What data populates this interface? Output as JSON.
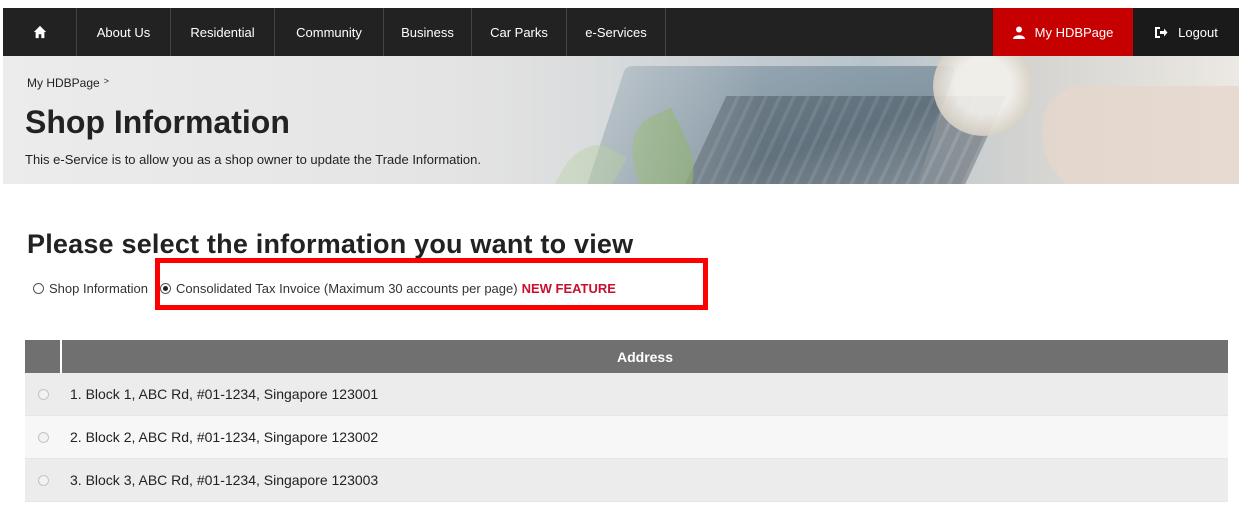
{
  "nav": {
    "items": [
      {
        "label": "About Us"
      },
      {
        "label": "Residential"
      },
      {
        "label": "Community"
      },
      {
        "label": "Business"
      },
      {
        "label": "Car Parks"
      },
      {
        "label": "e-Services"
      }
    ],
    "my_hdbpage": "My HDBPage",
    "logout": "Logout",
    "accent_color": "#c60000"
  },
  "hero": {
    "breadcrumb": "My HDBPage",
    "title": "Shop Information",
    "description": "This e-Service is to allow you as a shop owner to update the Trade Information."
  },
  "selection": {
    "heading": "Please select the information you want to view",
    "options": [
      {
        "label": "Shop Information",
        "checked": false
      },
      {
        "label": "Consolidated Tax Invoice (Maximum 30 accounts per page)",
        "checked": true
      }
    ],
    "badge": "NEW FEATURE",
    "badge_color": "#c8102e"
  },
  "table": {
    "header": "Address",
    "rows": [
      {
        "address": "1. Block 1, ABC Rd, #01-1234, Singapore 123001"
      },
      {
        "address": "2. Block 2, ABC Rd, #01-1234, Singapore 123002"
      },
      {
        "address": "3. Block 3, ABC Rd, #01-1234, Singapore 123003"
      }
    ]
  }
}
